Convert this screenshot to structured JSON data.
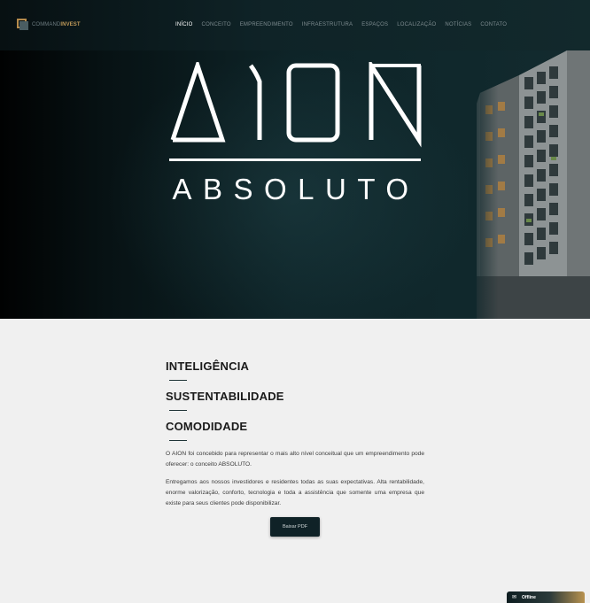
{
  "header": {
    "logo": {
      "part1": "COMMAND",
      "part2": "INVEST"
    },
    "nav": [
      {
        "label": "INÍCIO",
        "active": true
      },
      {
        "label": "CONCEITO",
        "active": false
      },
      {
        "label": "EMPREENDIMENTO",
        "active": false
      },
      {
        "label": "INFRAESTRUTURA",
        "active": false
      },
      {
        "label": "ESPAÇOS",
        "active": false
      },
      {
        "label": "LOCALIZAÇÃO",
        "active": false
      },
      {
        "label": "NOTÍCIAS",
        "active": false
      },
      {
        "label": "CONTATO",
        "active": false
      }
    ]
  },
  "hero": {
    "brand": "AION",
    "tagline": "ABSOLUTO"
  },
  "content": {
    "headings": [
      "INTELIGÊNCIA",
      "SUSTENTABILIDADE",
      "COMODIDADE"
    ],
    "paragraph1": "O AION foi concebido para representar o mais alto nível conceitual que um empreendimento pode oferecer: o conceito ABSOLUTO.",
    "paragraph2": "Entregamos aos nossos investidores e residentes todas as suas expectativas. Alta rentabilidade, enorme valorização, conforto, tecnologia e toda a assistência que somente uma empresa que existe para seus clientes pode disponibilizar.",
    "button": "Baixar PDF"
  },
  "chat": {
    "status": "Offline",
    "icon": "envelope-icon"
  },
  "colors": {
    "accent": "#b58b4c",
    "dark": "#0f2227"
  }
}
